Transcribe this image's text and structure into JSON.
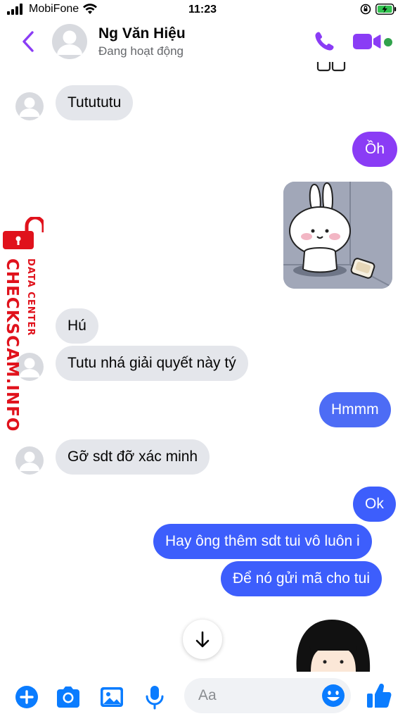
{
  "status_bar": {
    "carrier": "MobiFone",
    "time": "11:23"
  },
  "header": {
    "contact_name": "Ng Văn Hiệu",
    "contact_status": "Đang hoạt động"
  },
  "messages": [
    {
      "side": "in",
      "text": "Tutututu"
    },
    {
      "side": "out",
      "text": "Ồh"
    },
    {
      "side": "out",
      "type": "sticker",
      "icon": "bunny-sticker"
    },
    {
      "side": "in",
      "text": "Hú"
    },
    {
      "side": "in",
      "text": "Tutu nhá giải quyết này tý"
    },
    {
      "side": "out",
      "text": "Hmmm"
    },
    {
      "side": "in",
      "text": "Gỡ sdt đỡ xác minh"
    },
    {
      "side": "out",
      "text": "Ok"
    },
    {
      "side": "out",
      "text": "Hay ông thêm sdt tui vô luôn i"
    },
    {
      "side": "out",
      "text": "Để nó gửi mã cho tui"
    },
    {
      "side": "out",
      "type": "sticker",
      "icon": "girl-sticker"
    }
  ],
  "watermark": {
    "main": "CHECKSCAM.INFO",
    "sub": "DATA CENTER"
  },
  "composer": {
    "placeholder": "Aa"
  },
  "colors": {
    "accent": "#8a3cf5",
    "outgoing": "#3d5efc",
    "incoming": "#e4e6eb",
    "icons": "#0a7cff",
    "online": "#31a24c"
  }
}
